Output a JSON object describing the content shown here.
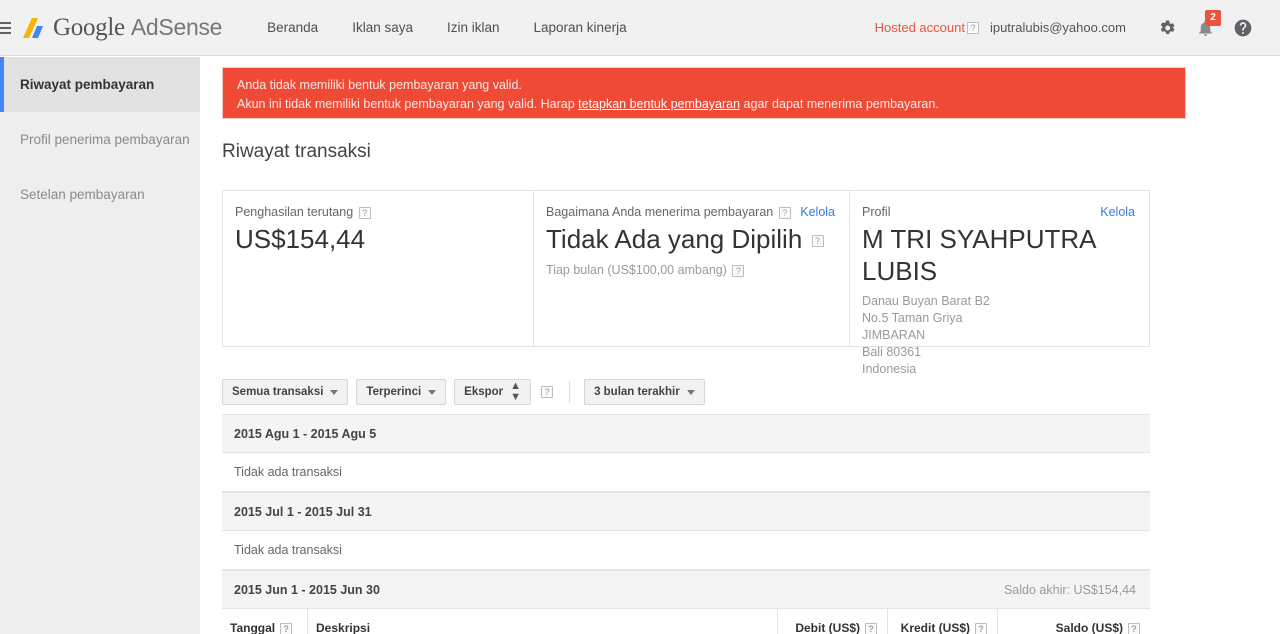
{
  "header": {
    "menu_icon": "hamburger-icon",
    "logo_google": "Google",
    "logo_product": "AdSense",
    "nav": [
      {
        "label": "Beranda"
      },
      {
        "label": "Iklan saya"
      },
      {
        "label": "Izin iklan"
      },
      {
        "label": "Laporan kinerja"
      }
    ],
    "hosted_account": "Hosted account",
    "help_mark": "?",
    "email": "iputralubis@yahoo.com",
    "settings_icon": "gear-icon",
    "notifications_icon": "bell-icon",
    "notifications_count": "2",
    "help_icon": "help-circle-icon",
    "accent_red": "#e8543f"
  },
  "sidebar": {
    "items": [
      {
        "label": "Riwayat pembayaran",
        "active": true
      },
      {
        "label": "Profil penerima pembayaran",
        "active": false
      },
      {
        "label": "Setelan pembayaran",
        "active": false
      }
    ],
    "active_accent": "#4285f4"
  },
  "alert": {
    "background": "#ef4a35",
    "line1": "Anda tidak memiliki bentuk pembayaran yang valid.",
    "line2_before": "Akun ini tidak memiliki bentuk pembayaran yang valid. Harap ",
    "line2_link": "tetapkan bentuk pembayaran",
    "line2_after": " agar dapat menerima pembayaran."
  },
  "page": {
    "title": "Riwayat transaksi"
  },
  "summary": {
    "earnings": {
      "label": "Penghasilan terutang",
      "help": "?",
      "value": "US$154,44"
    },
    "payment_method": {
      "label": "Bagaimana Anda menerima pembayaran",
      "help": "?",
      "value": "Tidak Ada yang Dipilih",
      "value_help": "?",
      "sub": "Tiap bulan (US$100,00 ambang)",
      "sub_help": "?",
      "manage": "Kelola"
    },
    "profile": {
      "label": "Profil",
      "manage": "Kelola",
      "name": "M TRI SYAHPUTRA LUBIS",
      "address": [
        "Danau Buyan Barat B2",
        "No.5 Taman Griya",
        "JIMBARAN",
        "Bali 80361",
        "Indonesia"
      ]
    }
  },
  "toolbar": {
    "transactions_filter": "Semua transaksi",
    "detail_filter": "Terperinci",
    "export": "Ekspor",
    "export_help": "?",
    "date_range": "3 bulan terakhir"
  },
  "transactions": {
    "groups": [
      {
        "period": "2015 Agu 1 - 2015 Agu 5",
        "balance": "",
        "empty": "Tidak ada transaksi"
      },
      {
        "period": "2015 Jul 1 - 2015 Jul 31",
        "balance": "",
        "empty": "Tidak ada transaksi"
      },
      {
        "period": "2015 Jun 1 - 2015 Jun 30",
        "balance": "Saldo akhir: US$154,44",
        "empty": ""
      }
    ],
    "columns": [
      {
        "label": "Tanggal",
        "help": "?"
      },
      {
        "label": "Deskripsi",
        "help": ""
      },
      {
        "label": "Debit (US$)",
        "help": "?"
      },
      {
        "label": "Kredit (US$)",
        "help": "?"
      },
      {
        "label": "Saldo (US$)",
        "help": "?"
      }
    ]
  }
}
